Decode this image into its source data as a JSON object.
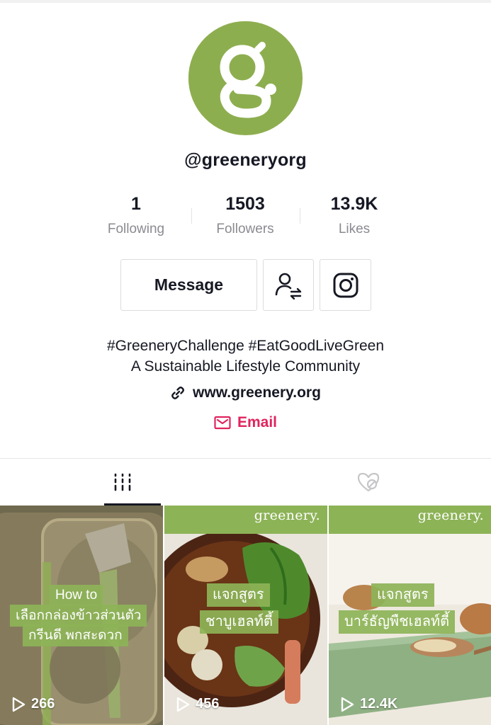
{
  "profile": {
    "username": "@greeneryorg",
    "avatar_letter": "g",
    "avatar_color": "#8dae4f"
  },
  "stats": {
    "following": {
      "value": "1",
      "label": "Following"
    },
    "followers": {
      "value": "1503",
      "label": "Followers"
    },
    "likes": {
      "value": "13.9K",
      "label": "Likes"
    }
  },
  "actions": {
    "message_label": "Message",
    "follow_icon": "user-swap-icon",
    "instagram_icon": "instagram-icon"
  },
  "bio": {
    "line1": "#GreeneryChallenge #EatGoodLiveGreen",
    "line2": "A Sustainable Lifestyle Community",
    "link": "www.greenery.org",
    "email_label": "Email"
  },
  "tabs": {
    "videos_icon": "grid-icon",
    "liked_icon": "liked-hidden-icon"
  },
  "videos": [
    {
      "caption_lines": [
        "How to",
        "เลือกกล่องข้าวส่วนตัว",
        "กรีนดี พกสะดวก"
      ],
      "views": "266",
      "brand": ""
    },
    {
      "caption_lines": [
        "แจกสูตร",
        "ชาบูเฮลท์ตี้"
      ],
      "views": "456",
      "brand": "greenery."
    },
    {
      "caption_lines": [
        "แจกสูตร",
        "บาร์ธัญพืชเฮลท์ตี้"
      ],
      "views": "12.4K",
      "brand": "greenery."
    }
  ],
  "colors": {
    "brand_green": "#8db357",
    "email_red": "#e0245e",
    "muted_text": "#8a8b91"
  }
}
